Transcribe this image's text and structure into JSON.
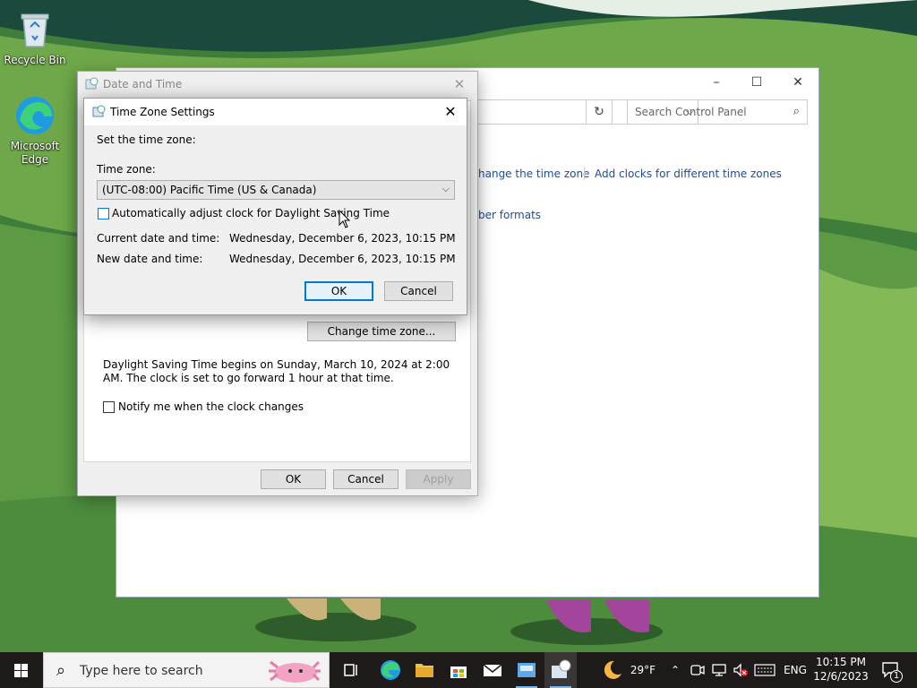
{
  "desktop": {
    "icons": [
      {
        "label": "Recycle Bin"
      },
      {
        "label": "Microsoft Edge"
      }
    ]
  },
  "control_panel": {
    "search_placeholder": "Search Control Panel",
    "links": {
      "change_time_zone": "hange the time zone",
      "add_clocks": "Add clocks for different time zones",
      "number_formats": "ber formats"
    }
  },
  "date_time_dialog": {
    "title": "Date and Time",
    "change_tz_button": "Change time zone...",
    "dst_info": "Daylight Saving Time begins on Sunday, March 10, 2024 at 2:00 AM. The clock is set to go forward 1 hour at that time.",
    "notify_label": "Notify me when the clock changes",
    "ok": "OK",
    "cancel": "Cancel",
    "apply": "Apply"
  },
  "tz_dialog": {
    "title": "Time Zone Settings",
    "set_tz_label": "Set the time zone:",
    "tz_label": "Time zone:",
    "tz_value": "(UTC-08:00) Pacific Time (US & Canada)",
    "auto_dst_label": "Automatically adjust clock for Daylight Saving Time",
    "current_label": "Current date and time:",
    "current_value": "Wednesday, December 6, 2023, 10:15 PM",
    "new_label": "New date and time:",
    "new_value": "Wednesday, December 6, 2023, 10:15 PM",
    "ok": "OK",
    "cancel": "Cancel"
  },
  "taskbar": {
    "search_placeholder": "Type here to search",
    "weather_temp": "29°F",
    "language": "ENG",
    "time": "10:15 PM",
    "date": "12/6/2023",
    "notification_count": "1"
  },
  "colors": {
    "accent": "#0078d7",
    "link": "#1a4ea3",
    "taskbar": "#1e1a1a"
  }
}
